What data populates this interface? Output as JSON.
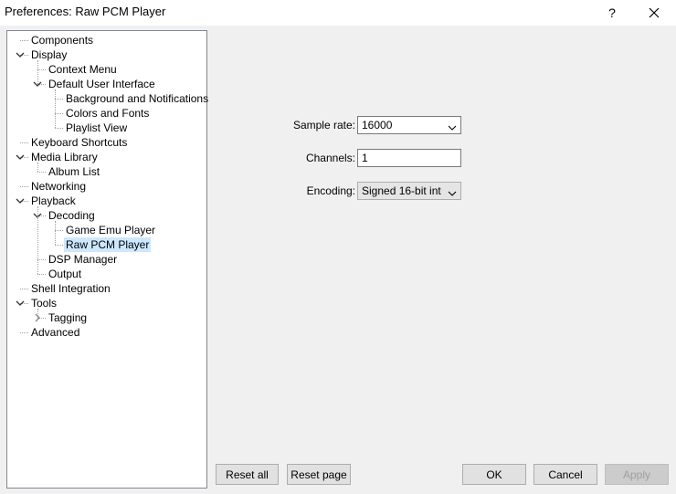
{
  "window": {
    "title": "Preferences: Raw PCM Player",
    "help_glyph": "?",
    "close_icon": "close-icon"
  },
  "tree": {
    "items": [
      {
        "label": "Components",
        "depth": 0,
        "expander": "none"
      },
      {
        "label": "Display",
        "depth": 0,
        "expander": "expanded"
      },
      {
        "label": "Context Menu",
        "depth": 1,
        "expander": "none"
      },
      {
        "label": "Default User Interface",
        "depth": 1,
        "expander": "expanded"
      },
      {
        "label": "Background and Notifications",
        "depth": 2,
        "expander": "none"
      },
      {
        "label": "Colors and Fonts",
        "depth": 2,
        "expander": "none"
      },
      {
        "label": "Playlist View",
        "depth": 2,
        "expander": "none"
      },
      {
        "label": "Keyboard Shortcuts",
        "depth": 0,
        "expander": "none"
      },
      {
        "label": "Media Library",
        "depth": 0,
        "expander": "expanded"
      },
      {
        "label": "Album List",
        "depth": 1,
        "expander": "none"
      },
      {
        "label": "Networking",
        "depth": 0,
        "expander": "none"
      },
      {
        "label": "Playback",
        "depth": 0,
        "expander": "expanded"
      },
      {
        "label": "Decoding",
        "depth": 1,
        "expander": "expanded"
      },
      {
        "label": "Game Emu Player",
        "depth": 2,
        "expander": "none"
      },
      {
        "label": "Raw PCM Player",
        "depth": 2,
        "expander": "none",
        "selected": true
      },
      {
        "label": "DSP Manager",
        "depth": 1,
        "expander": "none"
      },
      {
        "label": "Output",
        "depth": 1,
        "expander": "none"
      },
      {
        "label": "Shell Integration",
        "depth": 0,
        "expander": "none"
      },
      {
        "label": "Tools",
        "depth": 0,
        "expander": "expanded"
      },
      {
        "label": "Tagging",
        "depth": 1,
        "expander": "collapsed"
      },
      {
        "label": "Advanced",
        "depth": 0,
        "expander": "none"
      }
    ]
  },
  "form": {
    "sample_rate_label": "Sample rate:",
    "sample_rate_value": "16000",
    "channels_label": "Channels:",
    "channels_value": "1",
    "encoding_label": "Encoding:",
    "encoding_value": "Signed 16-bit int"
  },
  "buttons": {
    "reset_all": "Reset all",
    "reset_page": "Reset page",
    "ok": "OK",
    "cancel": "Cancel",
    "apply": "Apply"
  }
}
